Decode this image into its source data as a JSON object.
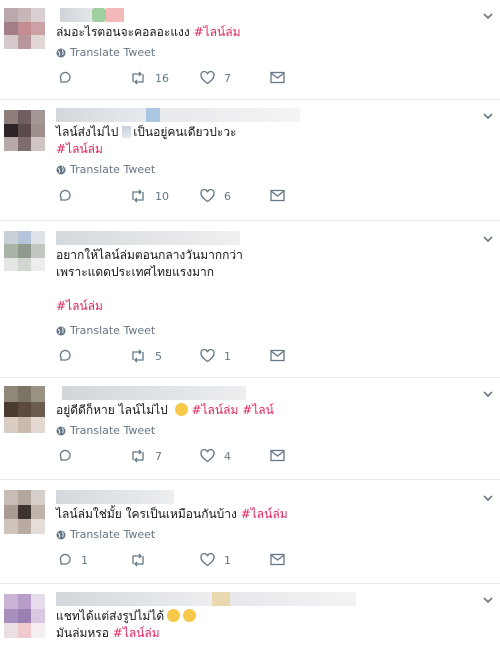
{
  "ui": {
    "translate_label": "Translate Tweet",
    "icons": {
      "reply": "reply-icon",
      "retweet": "retweet-icon",
      "like": "heart-icon",
      "dm": "envelope-icon",
      "caret": "chevron-down-icon",
      "translate": "globe-icon"
    }
  },
  "tweets": [
    {
      "text_before": "ล่มอะไรตอนจะคอลอะแงง",
      "hashtag": "#ไลน์ล่ม",
      "replies": "",
      "retweets": "16",
      "likes": "7"
    },
    {
      "line1_before": "ไลน์ส่งไม่ไป",
      "line1_after": "เป็นอยู่คนเดียวปะวะ",
      "hashtag": "#ไลน์ล่ม",
      "replies": "",
      "retweets": "10",
      "likes": "6"
    },
    {
      "line1": "อยากให้ไลน์ล่มตอนกลางวันมากกว่า",
      "line2": "เพราะแดดประเทศไทยแรงมาก",
      "hashtag": "#ไลน์ล่ม",
      "replies": "",
      "retweets": "5",
      "likes": "1"
    },
    {
      "text_before": "อยู่ดีดีก็หาย ไลน์ไม่ไป",
      "hashtag": "#ไลน์ล่ม",
      "hashtag2": "#ไลน์",
      "replies": "",
      "retweets": "7",
      "likes": "4"
    },
    {
      "text_before": "ไลน์ล่มใช่มั้ย ใครเป็นเหมือนกันบ้าง",
      "hashtag": "#ไลน์ล่ม",
      "replies": "1",
      "retweets": "",
      "likes": "1"
    },
    {
      "line1": "แชทได้แต่ส่งรูปไม่ได้",
      "line2_before": "มันล่มหรอ",
      "hashtag": "#ไลน์ล่ม"
    }
  ]
}
